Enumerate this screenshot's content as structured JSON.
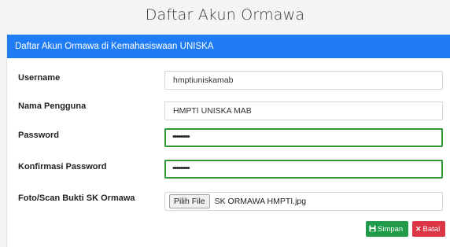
{
  "page": {
    "title": "Daftar Akun Ormawa"
  },
  "card": {
    "header": "Daftar Akun Ormawa di Kemahasiswaan UNISKA"
  },
  "form": {
    "username": {
      "label": "Username",
      "value": "hmptiuniskamab"
    },
    "nama_pengguna": {
      "label": "Nama Pengguna",
      "value": "HMPTI UNISKA MAB"
    },
    "password": {
      "label": "Password",
      "value": "•••••••••"
    },
    "konfirmasi_password": {
      "label": "Konfirmasi Password",
      "value": "•••••••••"
    },
    "foto": {
      "label": "Foto/Scan Bukti SK Ormawa",
      "button_label": "Pilih File",
      "file_name": "SK ORMAWA HMPTI.jpg"
    }
  },
  "actions": {
    "save_label": "Simpan",
    "save_icon": "save-icon",
    "cancel_label": "Batal",
    "cancel_icon": "close-icon"
  },
  "colors": {
    "header": "#1f7cf4",
    "valid_border": "#2e9a37",
    "save": "#1f9b4a",
    "cancel": "#dc3545"
  }
}
